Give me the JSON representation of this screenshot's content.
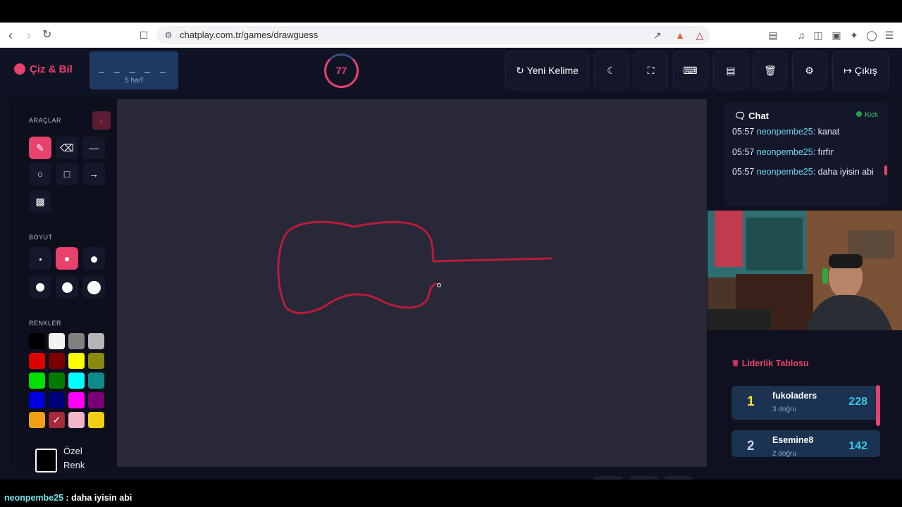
{
  "browser": {
    "url": "chatplay.com.tr/games/drawguess"
  },
  "header": {
    "logo": "Çiz & Bil",
    "word_blanks": "_ _ _ _ _",
    "word_length": "5 harf",
    "timer": "77",
    "buttons": {
      "new_word": "Yeni Kelime",
      "exit": "Çıkış"
    }
  },
  "tools": {
    "section_tools": "ARAÇLAR",
    "section_size": "BOYUT",
    "section_colors": "RENKLER",
    "custom_color": "Özel Renk",
    "colors": [
      "#000000",
      "#f2f2f2",
      "#808080",
      "#b5b5b5",
      "#e00000",
      "#7a0000",
      "#ffff00",
      "#8a8a10",
      "#00e000",
      "#007a00",
      "#00ffff",
      "#0f8a8a",
      "#0000e0",
      "#00007a",
      "#ff00ff",
      "#7a007a",
      "#f0a010",
      "#a8283c",
      "#f5b5c8",
      "#f0d010"
    ]
  },
  "chat": {
    "title": "Chat",
    "kick_label": "Kick",
    "messages": [
      {
        "time": "05:57",
        "user": "neonpembe25",
        "text": ": kanat"
      },
      {
        "time": "05:57",
        "user": "neonpembe25",
        "text": ": fırfır"
      },
      {
        "time": "05:57",
        "user": "neonpembe25",
        "text": ": daha iyisin abi"
      }
    ]
  },
  "leaderboard": {
    "title": "Liderlik Tablosu",
    "rows": [
      {
        "rank": "1",
        "name": "fukoladers",
        "sub": "3 doğru",
        "points": "228"
      },
      {
        "rank": "2",
        "name": "Esemine8",
        "sub": "2 doğru",
        "points": "142"
      }
    ]
  },
  "ticker": {
    "user": "neonpembe25",
    "text": " : daha iyisin abi"
  }
}
